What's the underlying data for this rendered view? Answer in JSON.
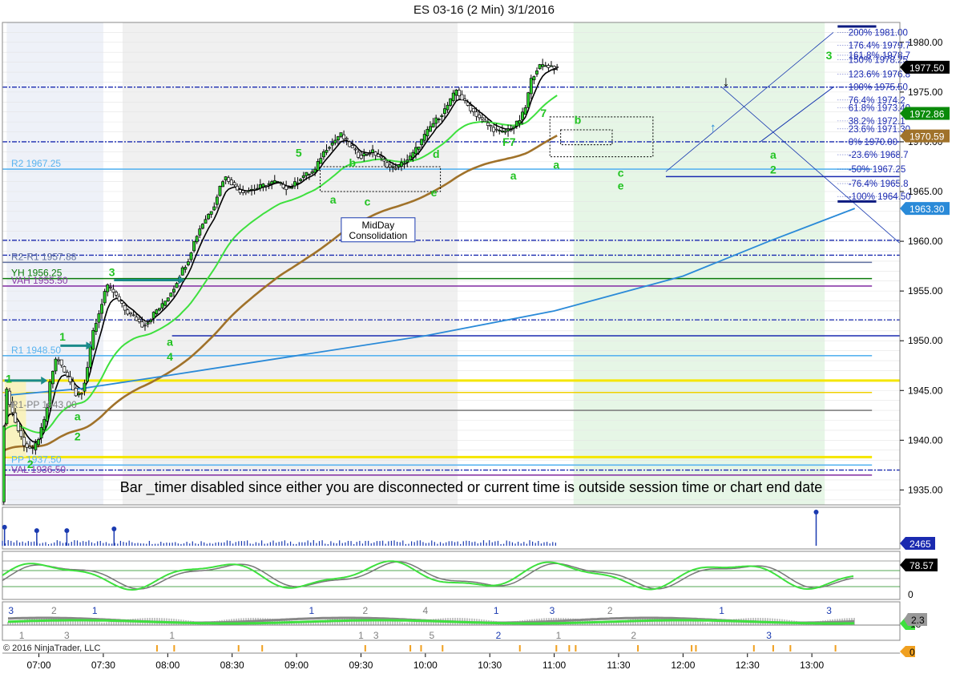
{
  "title": "ES 03-16 (2 Min)  3/1/2016",
  "copyright": "© 2016 NinjaTrader, LLC",
  "message": "Bar _timer disabled since either you are disconnected or current time is outside session time or chart end date",
  "chart_data": {
    "type": "candlestick",
    "ylim": [
      1933.5,
      1982
    ],
    "y_ticks": [
      1935,
      1940,
      1945,
      1950,
      1955,
      1960,
      1965,
      1970,
      1975,
      1980
    ],
    "y_tick_labels": [
      "1935.00",
      "1940.00",
      "1945.00",
      "1950.00",
      "1955.00",
      "1960.00",
      "1965.00",
      "1970.00",
      "1975.00",
      "1980.00"
    ],
    "x_ticks": [
      "07:00",
      "07:30",
      "08:00",
      "08:30",
      "09:00",
      "09:30",
      "10:00",
      "10:30",
      "11:00",
      "11:30",
      "12:00",
      "12:30",
      "13:00"
    ],
    "x_tick_minutes": [
      420,
      450,
      480,
      510,
      540,
      570,
      600,
      630,
      660,
      690,
      720,
      750,
      780
    ],
    "x_range_minutes": [
      403,
      821
    ],
    "price_markers": [
      {
        "label": "1977.50",
        "value": 1977.5,
        "color": "#000000"
      },
      {
        "label": "1972.86",
        "value": 1972.86,
        "color": "#0a8a0a"
      },
      {
        "label": "1970.59",
        "value": 1970.59,
        "color": "#a0722a"
      },
      {
        "label": "1963.30",
        "value": 1963.3,
        "color": "#2a8ad8"
      }
    ],
    "levels": [
      {
        "label": "R2 1967.25",
        "value": 1967.25,
        "color": "#5ab4f0"
      },
      {
        "label": "R2-R1 1957.88",
        "value": 1957.88,
        "color": "#6070a0"
      },
      {
        "label": "YH 1956.25",
        "value": 1956.25,
        "color": "#0a7a0a"
      },
      {
        "label": "VAH 1955.50",
        "value": 1955.5,
        "color": "#8a3aa8"
      },
      {
        "label": "R1 1948.50",
        "value": 1948.5,
        "color": "#5ab4f0"
      },
      {
        "label": "R1-PP 1943.00",
        "value": 1943.0,
        "color": "#808080"
      },
      {
        "label": "PP 1937.50",
        "value": 1937.5,
        "color": "#5ab4f0"
      },
      {
        "label": "VAL 1936.50",
        "value": 1936.5,
        "color": "#8a3aa8"
      }
    ],
    "fib_levels": [
      {
        "label": "200%",
        "value": 1981.0,
        "price": "1981.00"
      },
      {
        "label": "176.4%",
        "value": 1979.7,
        "price": "1979.7"
      },
      {
        "label": "161.8%",
        "value": 1978.7,
        "price": "1978.7"
      },
      {
        "label": "150%",
        "value": 1978.25,
        "price": "1978.25"
      },
      {
        "label": "123.6%",
        "value": 1976.8,
        "price": "1976.8"
      },
      {
        "label": "100%",
        "value": 1975.5,
        "price": "1975.50"
      },
      {
        "label": "76.4%",
        "value": 1974.2,
        "price": "1974.2"
      },
      {
        "label": "61.8%",
        "value": 1973.4,
        "price": "1973.40"
      },
      {
        "label": "38.2%",
        "value": 1972.1,
        "price": "1972.1"
      },
      {
        "label": "23.6%",
        "value": 1971.3,
        "price": "1971.30"
      },
      {
        "label": "0%",
        "value": 1970.0,
        "price": "1970.00"
      },
      {
        "label": "-23.6%",
        "value": 1968.7,
        "price": "1968.7"
      },
      {
        "label": "-50%",
        "value": 1967.25,
        "price": "1967.25"
      },
      {
        "label": "-76.4%",
        "value": 1965.8,
        "price": "1965.8"
      },
      {
        "label": "-100%",
        "value": 1964.5,
        "price": "1964.50"
      }
    ],
    "price_path": [
      [
        403,
        1933.8
      ],
      [
        405,
        1945.5
      ],
      [
        408,
        1943
      ],
      [
        411,
        1941
      ],
      [
        414,
        1939.5
      ],
      [
        418,
        1939
      ],
      [
        421,
        1940.5
      ],
      [
        424,
        1942.5
      ],
      [
        426,
        1946
      ],
      [
        429,
        1948.5
      ],
      [
        432,
        1947
      ],
      [
        435,
        1946
      ],
      [
        438,
        1944.5
      ],
      [
        441,
        1945
      ],
      [
        443,
        1947
      ],
      [
        446,
        1951
      ],
      [
        449,
        1953
      ],
      [
        452,
        1955.5
      ],
      [
        455,
        1955
      ],
      [
        458,
        1954
      ],
      [
        461,
        1953
      ],
      [
        464,
        1952.5
      ],
      [
        467,
        1952
      ],
      [
        469,
        1951.5
      ],
      [
        472,
        1952
      ],
      [
        475,
        1953
      ],
      [
        478,
        1953.5
      ],
      [
        481,
        1954.5
      ],
      [
        484,
        1955.5
      ],
      [
        487,
        1957
      ],
      [
        490,
        1958
      ],
      [
        493,
        1960
      ],
      [
        496,
        1961.5
      ],
      [
        499,
        1962.5
      ],
      [
        502,
        1963.5
      ],
      [
        505,
        1965.5
      ],
      [
        507,
        1966.5
      ],
      [
        510,
        1966
      ],
      [
        513,
        1965.2
      ],
      [
        516,
        1965
      ],
      [
        519,
        1965.2
      ],
      [
        522,
        1965.3
      ],
      [
        525,
        1965.6
      ],
      [
        528,
        1965.8
      ],
      [
        531,
        1966
      ],
      [
        534,
        1965.6
      ],
      [
        537,
        1965.3
      ],
      [
        540,
        1965.8
      ],
      [
        543,
        1966.5
      ],
      [
        546,
        1966.8
      ],
      [
        549,
        1967
      ],
      [
        552,
        1968.5
      ],
      [
        555,
        1969.5
      ],
      [
        558,
        1970
      ],
      [
        561,
        1970.8
      ],
      [
        564,
        1970
      ],
      [
        567,
        1969.2
      ],
      [
        570,
        1968.5
      ],
      [
        573,
        1968.8
      ],
      [
        576,
        1969
      ],
      [
        579,
        1968.5
      ],
      [
        582,
        1967.8
      ],
      [
        585,
        1967.3
      ],
      [
        588,
        1967.5
      ],
      [
        591,
        1968
      ],
      [
        594,
        1968.5
      ],
      [
        597,
        1969.5
      ],
      [
        600,
        1970.5
      ],
      [
        603,
        1971.5
      ],
      [
        606,
        1972.3
      ],
      [
        609,
        1973
      ],
      [
        612,
        1974
      ],
      [
        615,
        1975.2
      ],
      [
        618,
        1974.2
      ],
      [
        621,
        1973.5
      ],
      [
        624,
        1972.8
      ],
      [
        627,
        1972.2
      ],
      [
        630,
        1971.6
      ],
      [
        633,
        1971.2
      ],
      [
        636,
        1970.9
      ],
      [
        638,
        1971.1
      ],
      [
        641,
        1971.4
      ],
      [
        644,
        1972
      ],
      [
        647,
        1973.2
      ],
      [
        650,
        1976.3
      ],
      [
        653,
        1977.5
      ],
      [
        656,
        1977.7
      ],
      [
        659,
        1977.6
      ],
      [
        662,
        1977.5
      ]
    ],
    "bar_count": 193,
    "volume_spikes": [
      {
        "minute": 404,
        "v": 0.55
      },
      {
        "minute": 419,
        "v": 0.45
      },
      {
        "minute": 433,
        "v": 0.45
      },
      {
        "minute": 455,
        "v": 0.5
      },
      {
        "minute": 782,
        "v": 1.0
      }
    ],
    "volume_value": "2465",
    "oscillator_value": "78.57",
    "oscillator_zero": "0",
    "macd_values": [
      "2.3",
      "13"
    ],
    "bottom_value": "0",
    "wave_labels": [
      {
        "t": "1",
        "m": 406,
        "v": 1945.8,
        "c": "#22c322"
      },
      {
        "t": "2",
        "m": 416,
        "v": 1937.2,
        "c": "#22c322"
      },
      {
        "t": "1",
        "m": 431,
        "v": 1950,
        "c": "#22c322"
      },
      {
        "t": "a",
        "m": 438,
        "v": 1942,
        "c": "#22c322"
      },
      {
        "t": "2",
        "m": 438,
        "v": 1940,
        "c": "#22c322"
      },
      {
        "t": "3",
        "m": 454,
        "v": 1956.5,
        "c": "#22c322"
      },
      {
        "t": "a",
        "m": 481,
        "v": 1949.5,
        "c": "#22c322"
      },
      {
        "t": "4",
        "m": 481,
        "v": 1948,
        "c": "#22c322"
      },
      {
        "t": "5",
        "m": 541,
        "v": 1968.5,
        "c": "#22c322"
      },
      {
        "t": "a",
        "m": 557,
        "v": 1963.8,
        "c": "#22c322"
      },
      {
        "t": "b",
        "m": 566,
        "v": 1967.5,
        "c": "#22c322"
      },
      {
        "t": "c",
        "m": 573,
        "v": 1963.6,
        "c": "#22c322"
      },
      {
        "t": "d",
        "m": 605,
        "v": 1968.4,
        "c": "#22c322"
      },
      {
        "t": "e",
        "m": 604,
        "v": 1964.5,
        "c": "#22c322"
      },
      {
        "t": "F7",
        "m": 639,
        "v": 1969.6,
        "c": "#22c322"
      },
      {
        "t": "a",
        "m": 641,
        "v": 1966.2,
        "c": "#22c322"
      },
      {
        "t": "7",
        "m": 655,
        "v": 1972.5,
        "c": "#22c322"
      },
      {
        "t": "a",
        "m": 661,
        "v": 1967.3,
        "c": "#22c322"
      },
      {
        "t": "b",
        "m": 671,
        "v": 1971.8,
        "c": "#22c322"
      },
      {
        "t": "c",
        "m": 691,
        "v": 1966.5,
        "c": "#22c322"
      },
      {
        "t": "e",
        "m": 691,
        "v": 1965.2,
        "c": "#22c322"
      },
      {
        "t": "a",
        "m": 762,
        "v": 1968.3,
        "c": "#22c322"
      },
      {
        "t": "2",
        "m": 762,
        "v": 1966.8,
        "c": "#22c322"
      },
      {
        "t": "3",
        "m": 788,
        "v": 1978.3,
        "c": "#22c322"
      }
    ],
    "annotation_box": {
      "text": [
        "MidDay",
        "Consolidation"
      ],
      "m": 578,
      "v": 1962.2
    },
    "sub_labels": [
      {
        "t": "3",
        "m": 407,
        "row": "top",
        "c": "#1a3ab0"
      },
      {
        "t": "2",
        "m": 427,
        "row": "top",
        "c": "#808080"
      },
      {
        "t": "1",
        "m": 446,
        "row": "top",
        "c": "#1a3ab0"
      },
      {
        "t": "1",
        "m": 547,
        "row": "top",
        "c": "#1a3ab0"
      },
      {
        "t": "2",
        "m": 572,
        "row": "top",
        "c": "#808080"
      },
      {
        "t": "4",
        "m": 600,
        "row": "top",
        "c": "#808080"
      },
      {
        "t": "1",
        "m": 633,
        "row": "top",
        "c": "#1a3ab0"
      },
      {
        "t": "3",
        "m": 659,
        "row": "top",
        "c": "#1a3ab0"
      },
      {
        "t": "2",
        "m": 686,
        "row": "top",
        "c": "#808080"
      },
      {
        "t": "1",
        "m": 738,
        "row": "top",
        "c": "#1a3ab0"
      },
      {
        "t": "3",
        "m": 788,
        "row": "top",
        "c": "#1a3ab0"
      },
      {
        "t": "1",
        "m": 412,
        "row": "bot",
        "c": "#808080"
      },
      {
        "t": "3",
        "m": 433,
        "row": "bot",
        "c": "#808080"
      },
      {
        "t": "1",
        "m": 482,
        "row": "bot",
        "c": "#808080"
      },
      {
        "t": "1",
        "m": 570,
        "row": "bot",
        "c": "#808080"
      },
      {
        "t": "3",
        "m": 577,
        "row": "bot",
        "c": "#808080"
      },
      {
        "t": "5",
        "m": 603,
        "row": "bot",
        "c": "#808080"
      },
      {
        "t": "2",
        "m": 634,
        "row": "bot",
        "c": "#1a3ab0"
      },
      {
        "t": "1",
        "m": 662,
        "row": "bot",
        "c": "#808080"
      },
      {
        "t": "2",
        "m": 697,
        "row": "bot",
        "c": "#808080"
      },
      {
        "t": "3",
        "m": 760,
        "row": "bot",
        "c": "#1a3ab0"
      }
    ],
    "session_markers": [
      475,
      483,
      513,
      524,
      572,
      593,
      598,
      608,
      644,
      661,
      667,
      670,
      699,
      724,
      726,
      753,
      762,
      770,
      791
    ]
  }
}
